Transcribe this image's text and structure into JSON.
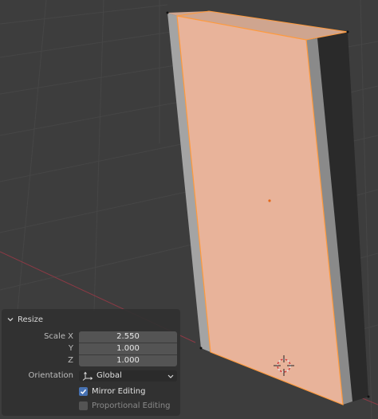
{
  "panel": {
    "title": "Resize",
    "scale_label": "Scale X",
    "y_label": "Y",
    "z_label": "Z",
    "scale_x": "2.550",
    "scale_y": "1.000",
    "scale_z": "1.000",
    "orientation_label": "Orientation",
    "orientation_value": "Global",
    "mirror_editing_label": "Mirror Editing",
    "mirror_editing_checked": true,
    "proportional_editing_label": "Proportional Editing",
    "proportional_editing_checked": false
  },
  "colors": {
    "viewport_bg": "#3d3d3d",
    "grid_line": "#464646",
    "x_axis": "#8c3a45",
    "selected_face": "#e8b39a",
    "selection_edge": "#ff9a3c",
    "side_light": "#a4a4a4",
    "side_dark": "#2a2a2a",
    "checkbox_active": "#4772b3"
  },
  "icons": [
    "chevron-down-icon",
    "orientation-axes-icon",
    "check-icon",
    "3d-cursor-icon"
  ]
}
